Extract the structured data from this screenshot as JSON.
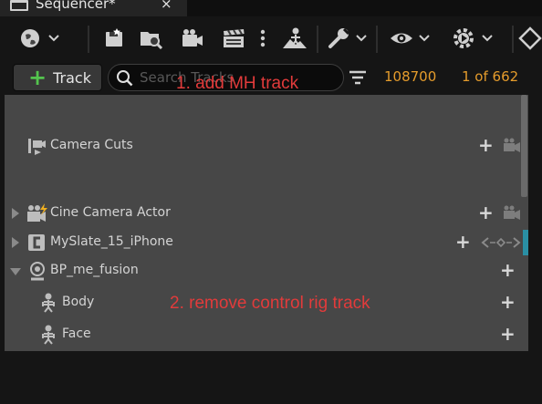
{
  "tab": {
    "title": "Sequencer*",
    "close": "×"
  },
  "toolbar": {
    "icons": [
      "world-icon",
      "save-icon",
      "browse-icon",
      "camera-icon",
      "clapper-icon",
      "more-icon",
      "actor-icon",
      "wrench-icon",
      "eye-icon",
      "play-settings-icon",
      "diamond-icon"
    ]
  },
  "filterbar": {
    "add_track_label": "Track",
    "search_placeholder": "Search Tracks",
    "current_frame": "108700",
    "count": "1 of 662"
  },
  "annotations": {
    "first": "1. add MH track",
    "second": "2. remove control rig track"
  },
  "tracks": [
    {
      "label": "Camera Cuts",
      "icon": "camera-cuts-icon"
    },
    {
      "label": "Cine Camera Actor",
      "icon": "cine-camera-icon",
      "collapsed": true
    },
    {
      "label": "MySlate_15_iPhone",
      "icon": "slate-icon",
      "collapsed": true
    },
    {
      "label": "BP_me_fusion",
      "icon": "actor-icon",
      "expanded": true
    },
    {
      "label": "Body",
      "icon": "skeleton-icon"
    },
    {
      "label": "Face",
      "icon": "skeleton-icon"
    }
  ],
  "colors": {
    "accent_green": "#54c44e",
    "frame_orange": "#e59c2c",
    "annotation_red": "#e23b3b",
    "panel_bg": "#474747",
    "teal": "#2a8fa4"
  }
}
